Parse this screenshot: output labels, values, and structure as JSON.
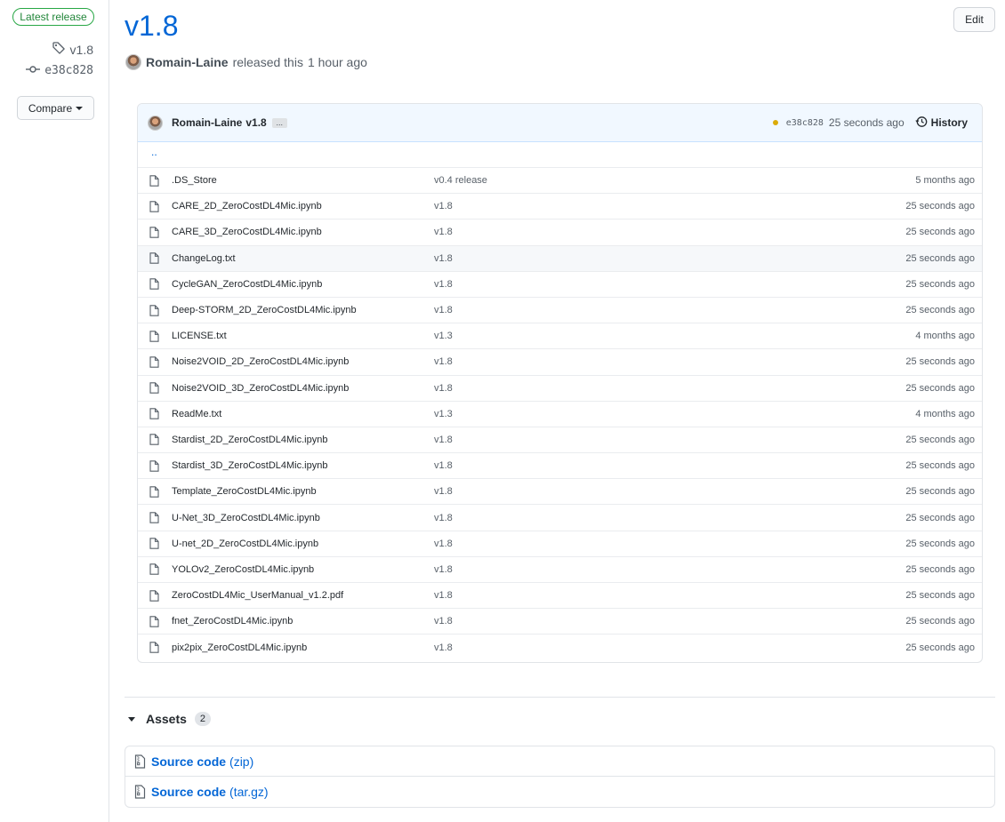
{
  "sidebar": {
    "badge": "Latest release",
    "tag": "v1.8",
    "commit": "e38c828",
    "compare_label": "Compare"
  },
  "header": {
    "title": "v1.8",
    "edit_label": "Edit",
    "author": "Romain-Laine",
    "released_text": "released this",
    "released_ago": "1 hour ago"
  },
  "file_browser": {
    "commit_author": "Romain-Laine",
    "commit_message": "v1.8",
    "ellipsis": "...",
    "commit_sha": "e38c828",
    "commit_age": "25 seconds ago",
    "history_label": "History",
    "parent_dir": "..",
    "files": [
      {
        "name": ".DS_Store",
        "commit": "v0.4 release",
        "age": "5 months ago"
      },
      {
        "name": "CARE_2D_ZeroCostDL4Mic.ipynb",
        "commit": "v1.8",
        "age": "25 seconds ago"
      },
      {
        "name": "CARE_3D_ZeroCostDL4Mic.ipynb",
        "commit": "v1.8",
        "age": "25 seconds ago"
      },
      {
        "name": "ChangeLog.txt",
        "commit": "v1.8",
        "age": "25 seconds ago"
      },
      {
        "name": "CycleGAN_ZeroCostDL4Mic.ipynb",
        "commit": "v1.8",
        "age": "25 seconds ago"
      },
      {
        "name": "Deep-STORM_2D_ZeroCostDL4Mic.ipynb",
        "commit": "v1.8",
        "age": "25 seconds ago"
      },
      {
        "name": "LICENSE.txt",
        "commit": "v1.3",
        "age": "4 months ago"
      },
      {
        "name": "Noise2VOID_2D_ZeroCostDL4Mic.ipynb",
        "commit": "v1.8",
        "age": "25 seconds ago"
      },
      {
        "name": "Noise2VOID_3D_ZeroCostDL4Mic.ipynb",
        "commit": "v1.8",
        "age": "25 seconds ago"
      },
      {
        "name": "ReadMe.txt",
        "commit": "v1.3",
        "age": "4 months ago"
      },
      {
        "name": "Stardist_2D_ZeroCostDL4Mic.ipynb",
        "commit": "v1.8",
        "age": "25 seconds ago"
      },
      {
        "name": "Stardist_3D_ZeroCostDL4Mic.ipynb",
        "commit": "v1.8",
        "age": "25 seconds ago"
      },
      {
        "name": "Template_ZeroCostDL4Mic.ipynb",
        "commit": "v1.8",
        "age": "25 seconds ago"
      },
      {
        "name": "U-Net_3D_ZeroCostDL4Mic.ipynb",
        "commit": "v1.8",
        "age": "25 seconds ago"
      },
      {
        "name": "U-net_2D_ZeroCostDL4Mic.ipynb",
        "commit": "v1.8",
        "age": "25 seconds ago"
      },
      {
        "name": "YOLOv2_ZeroCostDL4Mic.ipynb",
        "commit": "v1.8",
        "age": "25 seconds ago"
      },
      {
        "name": "ZeroCostDL4Mic_UserManual_v1.2.pdf",
        "commit": "v1.8",
        "age": "25 seconds ago"
      },
      {
        "name": "fnet_ZeroCostDL4Mic.ipynb",
        "commit": "v1.8",
        "age": "25 seconds ago"
      },
      {
        "name": "pix2pix_ZeroCostDL4Mic.ipynb",
        "commit": "v1.8",
        "age": "25 seconds ago"
      }
    ]
  },
  "assets": {
    "label": "Assets",
    "count": "2",
    "items": [
      {
        "name": "Source code",
        "ext": "(zip)"
      },
      {
        "name": "Source code",
        "ext": "(tar.gz)"
      }
    ]
  },
  "colors": {
    "link": "#0366d6",
    "badge_green": "#28a745",
    "status_pending": "#dbab09",
    "header_bg": "#f1f8ff"
  },
  "icons": [
    "tag-icon",
    "commit-icon",
    "caret-down-icon",
    "file-icon",
    "history-icon",
    "zip-icon",
    "triangle-down-icon"
  ]
}
